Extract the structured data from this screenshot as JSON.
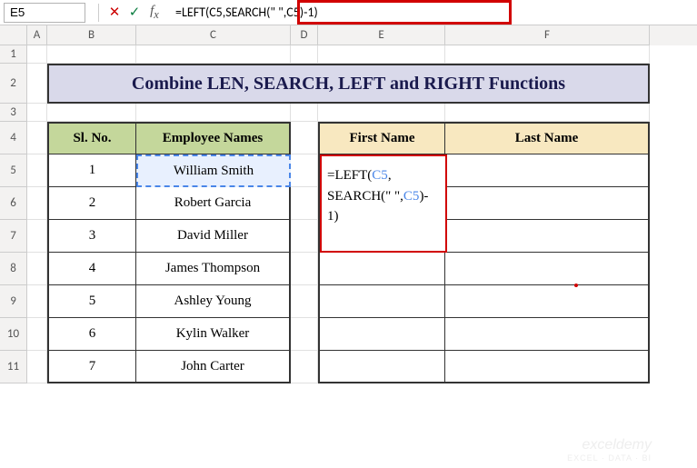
{
  "nameBox": "E5",
  "formulaBar": "=LEFT(C5,SEARCH(\" \",C5)-1)",
  "columns": [
    "A",
    "B",
    "C",
    "D",
    "E",
    "F"
  ],
  "rows": [
    "1",
    "2",
    "3",
    "4",
    "5",
    "6",
    "7",
    "8",
    "9",
    "10",
    "11"
  ],
  "title": "Combine LEN, SEARCH, LEFT and RIGHT Functions",
  "headers": {
    "slno": "Sl. No.",
    "empname": "Employee Names",
    "fname": "First Name",
    "lname": "Last Name"
  },
  "table": [
    {
      "no": "1",
      "name": "William Smith"
    },
    {
      "no": "2",
      "name": "Robert Garcia"
    },
    {
      "no": "3",
      "name": "David Miller"
    },
    {
      "no": "4",
      "name": "James Thompson"
    },
    {
      "no": "5",
      "name": "Ashley Young"
    },
    {
      "no": "6",
      "name": "Kylin Walker"
    },
    {
      "no": "7",
      "name": "John Carter"
    }
  ],
  "overlay": {
    "line1": "=LEFT(",
    "ref1": "C5",
    "line1b": ",",
    "line2": "SEARCH(\" \",",
    "ref2": "C5",
    "line2b": ")-",
    "line3": "1)"
  },
  "watermark": {
    "l1": "exceldemy",
    "l2": "EXCEL · DATA · BI"
  }
}
